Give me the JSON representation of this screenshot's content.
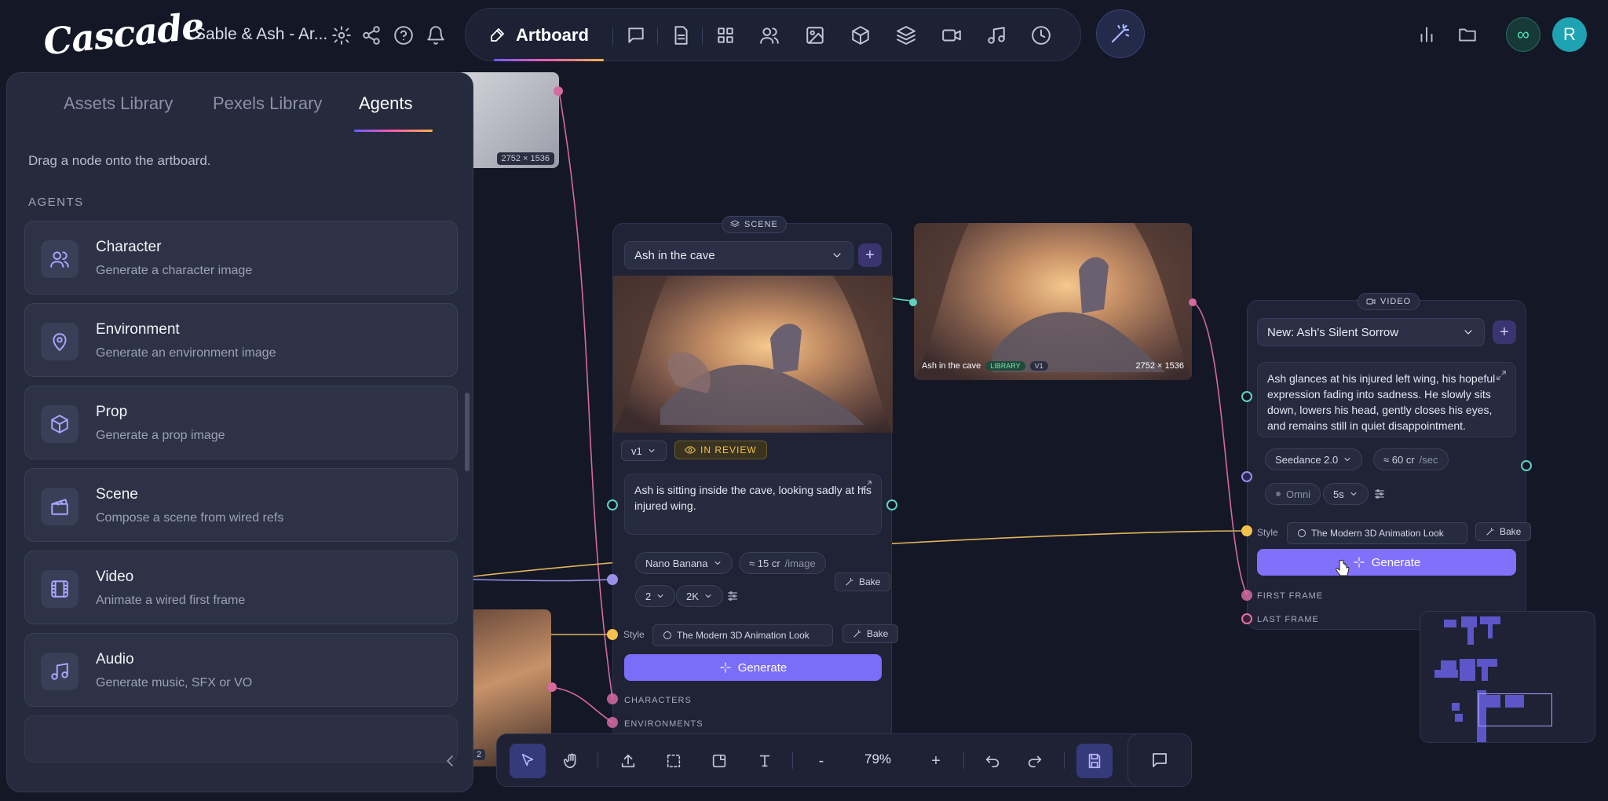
{
  "app": {
    "logo": "Cascade",
    "project": "Sable & Ash - Ar..."
  },
  "toolbar": {
    "artboard_label": "Artboard"
  },
  "user": {
    "avatar_initial": "R",
    "infinity": "∞"
  },
  "panel": {
    "tabs": [
      "Assets Library",
      "Pexels Library",
      "Agents"
    ],
    "active_tab": "Agents",
    "hint": "Drag a node onto the artboard.",
    "section": "AGENTS",
    "agents": [
      {
        "title": "Character",
        "subtitle": "Generate a character image",
        "icon": "users-icon"
      },
      {
        "title": "Environment",
        "subtitle": "Generate an environment image",
        "icon": "map-pin-icon"
      },
      {
        "title": "Prop",
        "subtitle": "Generate a prop image",
        "icon": "cube-icon"
      },
      {
        "title": "Scene",
        "subtitle": "Compose a scene from wired refs",
        "icon": "clapper-icon"
      },
      {
        "title": "Video",
        "subtitle": "Animate a wired first frame",
        "icon": "film-icon"
      },
      {
        "title": "Audio",
        "subtitle": "Generate music, SFX or VO",
        "icon": "music-icon"
      }
    ]
  },
  "top_left_image": {
    "dims": "2752 × 1536"
  },
  "bottom_left_image": {
    "badge": "2"
  },
  "scene_node": {
    "tag": "SCENE",
    "select": "Ash in the cave",
    "version": "v1",
    "status": "IN REVIEW",
    "prompt": "Ash is sitting inside the cave, looking sadly at his injured wing.",
    "model": "Nano Banana",
    "cost": "≈ 15 cr",
    "cost_unit": "/image",
    "count": "2",
    "resolution": "2K",
    "bake": "Bake",
    "style_label": "Style",
    "style": "The Modern 3D Animation Look",
    "generate": "Generate",
    "ports": [
      "CHARACTERS",
      "ENVIRONMENTS"
    ]
  },
  "output_image": {
    "caption": "Ash in the cave",
    "library": "LIBRARY",
    "version": "V1",
    "dims": "2752 × 1536"
  },
  "video_node": {
    "tag": "VIDEO",
    "select": "New: Ash's Silent Sorrow",
    "prompt": "Ash glances at his injured left wing, his hopeful expression fading into sadness. He slowly sits down, lowers his head, gently closes his eyes, and remains still in quiet disappointment.",
    "model": "Seedance 2.0",
    "cost": "≈ 60 cr",
    "cost_unit": "/sec",
    "mode": "Omni",
    "duration": "5s",
    "style_label": "Style",
    "style": "The Modern 3D Animation Look",
    "bake": "Bake",
    "generate": "Generate",
    "ports": [
      "FIRST FRAME",
      "LAST FRAME"
    ]
  },
  "bottom_toolbar": {
    "zoom": "79%",
    "minus": "-",
    "plus": "+"
  },
  "colors": {
    "accent": "#7a6df7",
    "port_teal": "#5fd1c0",
    "port_yellow": "#f2c14e",
    "port_pink": "#e071a8",
    "port_violet": "#9a8fe8"
  }
}
